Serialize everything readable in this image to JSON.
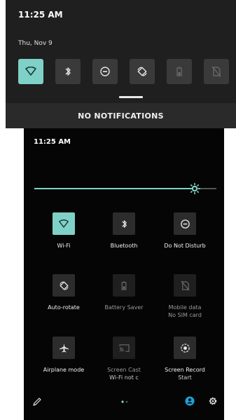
{
  "top_panel": {
    "time": "11:25 AM",
    "date": "Thu, Nov 9",
    "tiles": [
      {
        "name": "wifi",
        "state": "on",
        "icon": "wifi-icon"
      },
      {
        "name": "bluetooth",
        "state": "off",
        "icon": "bluetooth-icon"
      },
      {
        "name": "do-not-disturb",
        "state": "off",
        "icon": "do-not-disturb-icon"
      },
      {
        "name": "auto-rotate",
        "state": "off",
        "icon": "auto-rotate-icon"
      },
      {
        "name": "battery-saver",
        "state": "disabled",
        "icon": "battery-icon"
      },
      {
        "name": "mobile-data",
        "state": "disabled",
        "icon": "no-sim-icon"
      }
    ],
    "notification_text": "NO NOTIFICATIONS"
  },
  "quick_settings": {
    "time": "11:25 AM",
    "brightness": 0.88,
    "tiles": [
      {
        "label": "Wi-Fi",
        "sublabel": "",
        "state": "on",
        "icon": "wifi-icon"
      },
      {
        "label": "Bluetooth",
        "sublabel": "",
        "state": "off",
        "icon": "bluetooth-icon"
      },
      {
        "label": "Do Not Disturb",
        "sublabel": "",
        "state": "off",
        "icon": "do-not-disturb-icon"
      },
      {
        "label": "Auto-rotate",
        "sublabel": "",
        "state": "off",
        "icon": "auto-rotate-icon"
      },
      {
        "label": "Battery Saver",
        "sublabel": "",
        "state": "disabled",
        "icon": "battery-icon"
      },
      {
        "label": "Mobile data",
        "sublabel": "No SIM card",
        "state": "disabled",
        "icon": "no-sim-icon"
      },
      {
        "label": "Airplane mode",
        "sublabel": "",
        "state": "off",
        "icon": "airplane-icon"
      },
      {
        "label": "Screen Cast",
        "sublabel": "Wi-Fi not c",
        "state": "disabled",
        "icon": "cast-icon"
      },
      {
        "label": "Screen Record",
        "sublabel": "Start",
        "state": "off",
        "icon": "record-icon"
      }
    ],
    "footer": {
      "edit_icon": "pencil-icon",
      "page_indicator": "page-dots",
      "user_icon": "user-icon",
      "settings_icon": "gear-icon"
    }
  },
  "colors": {
    "accent": "#7fd1c8",
    "panel": "#1f1f1f",
    "qs_background": "#050505"
  }
}
